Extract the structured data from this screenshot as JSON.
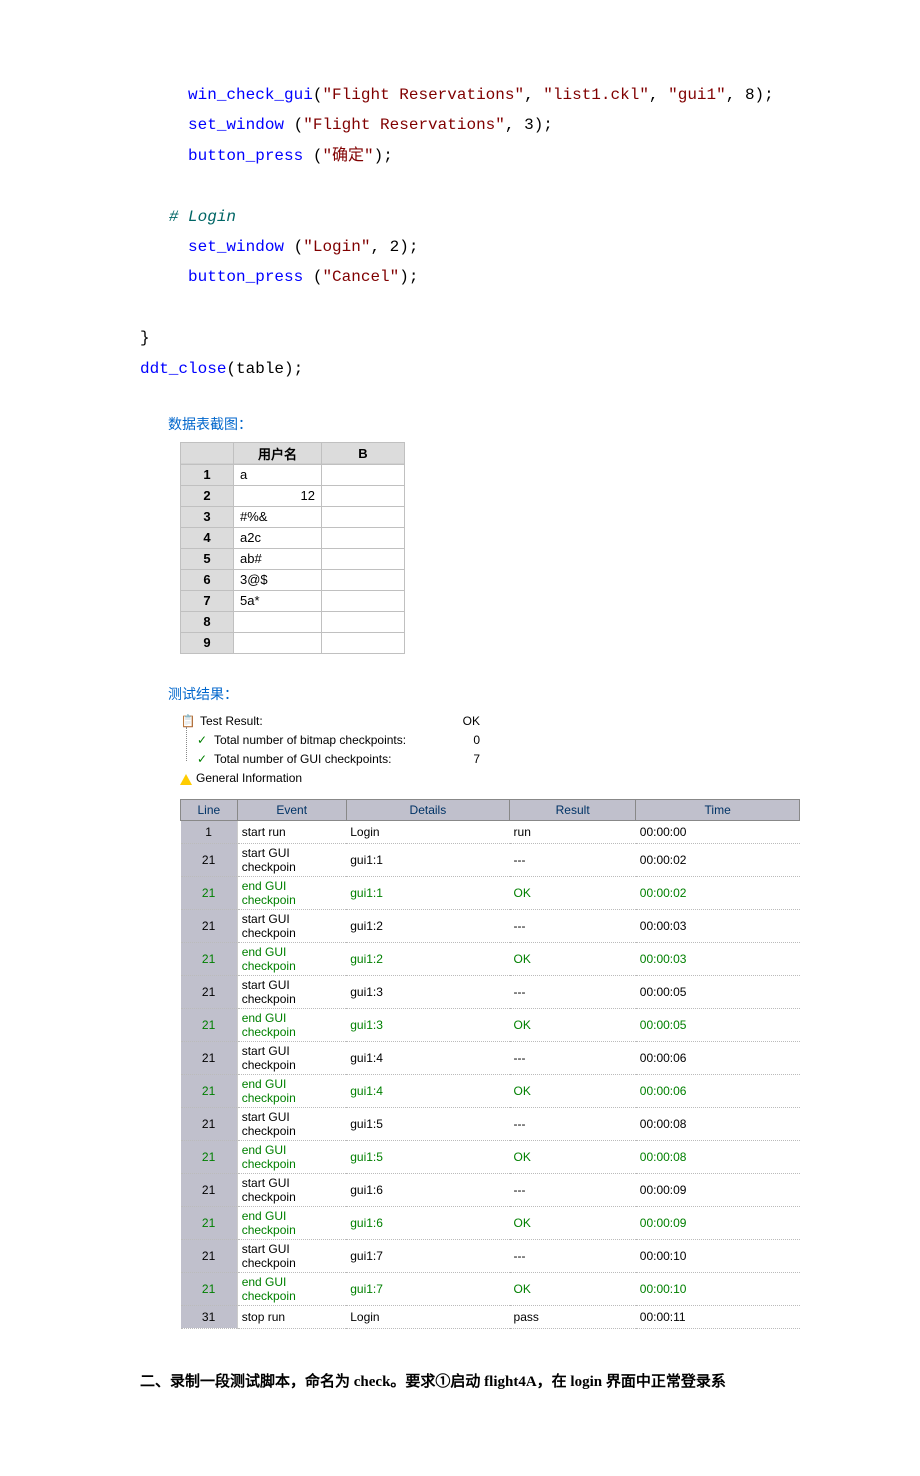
{
  "code": {
    "l1a": "win_check_gui",
    "l1b": "(",
    "l1c": "\"Flight Reservations\"",
    "l1d": ", ",
    "l1e": "\"list1.ckl\"",
    "l1f": ", ",
    "l1g": "\"gui1\"",
    "l1h": ", ",
    "l1i": "8",
    "l1j": ");",
    "l2a": "set_window",
    "l2b": " (",
    "l2c": "\"Flight Reservations\"",
    "l2d": ", ",
    "l2e": "3",
    "l2f": ");",
    "l3a": "button_press",
    "l3b": " (",
    "l3c": "\"确定\"",
    "l3d": ");",
    "comment": "# Login",
    "l4a": "set_window",
    "l4b": " (",
    "l4c": "\"Login\"",
    "l4d": ", ",
    "l4e": "2",
    "l4f": ");",
    "l5a": "button_press",
    "l5b": " (",
    "l5c": "\"Cancel\"",
    "l5d": ");",
    "brace": "}",
    "close": "ddt_close",
    "closeArg": "(table);"
  },
  "labels": {
    "dataTable": "数据表截图：",
    "testResult": "测试结果："
  },
  "sheet": {
    "header": {
      "username": "用户名",
      "b": "B"
    },
    "rows": [
      {
        "n": "1",
        "a": "a",
        "b": ""
      },
      {
        "n": "2",
        "a": "12",
        "b": "",
        "right": true
      },
      {
        "n": "3",
        "a": "#%&",
        "b": ""
      },
      {
        "n": "4",
        "a": "a2c",
        "b": ""
      },
      {
        "n": "5",
        "a": "ab#",
        "b": ""
      },
      {
        "n": "6",
        "a": "3@$",
        "b": ""
      },
      {
        "n": "7",
        "a": "5a*",
        "b": ""
      },
      {
        "n": "8",
        "a": "",
        "b": ""
      },
      {
        "n": "9",
        "a": "",
        "b": ""
      }
    ]
  },
  "tree": {
    "r1": {
      "label": "Test Result:",
      "val": "OK"
    },
    "r2": {
      "label": "Total number of bitmap checkpoints:",
      "val": "0"
    },
    "r3": {
      "label": "Total number of GUI checkpoints:",
      "val": "7"
    },
    "r4": {
      "label": "General Information"
    }
  },
  "results": {
    "headers": {
      "line": "Line",
      "event": "Event",
      "details": "Details",
      "result": "Result",
      "time": "Time"
    },
    "rows": [
      {
        "line": "1",
        "event": "start run",
        "details": "Login",
        "result": "run",
        "time": "00:00:00",
        "green": false
      },
      {
        "line": "21",
        "event": "start GUI checkpoin",
        "details": "gui1:1",
        "result": "---",
        "time": "00:00:02",
        "green": false
      },
      {
        "line": "21",
        "event": "end GUI checkpoin",
        "details": "gui1:1",
        "result": "OK",
        "time": "00:00:02",
        "green": true
      },
      {
        "line": "21",
        "event": "start GUI checkpoin",
        "details": "gui1:2",
        "result": "---",
        "time": "00:00:03",
        "green": false
      },
      {
        "line": "21",
        "event": "end GUI checkpoin",
        "details": "gui1:2",
        "result": "OK",
        "time": "00:00:03",
        "green": true
      },
      {
        "line": "21",
        "event": "start GUI checkpoin",
        "details": "gui1:3",
        "result": "---",
        "time": "00:00:05",
        "green": false
      },
      {
        "line": "21",
        "event": "end GUI checkpoin",
        "details": "gui1:3",
        "result": "OK",
        "time": "00:00:05",
        "green": true
      },
      {
        "line": "21",
        "event": "start GUI checkpoin",
        "details": "gui1:4",
        "result": "---",
        "time": "00:00:06",
        "green": false
      },
      {
        "line": "21",
        "event": "end GUI checkpoin",
        "details": "gui1:4",
        "result": "OK",
        "time": "00:00:06",
        "green": true
      },
      {
        "line": "21",
        "event": "start GUI checkpoin",
        "details": "gui1:5",
        "result": "---",
        "time": "00:00:08",
        "green": false
      },
      {
        "line": "21",
        "event": "end GUI checkpoin",
        "details": "gui1:5",
        "result": "OK",
        "time": "00:00:08",
        "green": true
      },
      {
        "line": "21",
        "event": "start GUI checkpoin",
        "details": "gui1:6",
        "result": "---",
        "time": "00:00:09",
        "green": false
      },
      {
        "line": "21",
        "event": "end GUI checkpoin",
        "details": "gui1:6",
        "result": "OK",
        "time": "00:00:09",
        "green": true
      },
      {
        "line": "21",
        "event": "start GUI checkpoin",
        "details": "gui1:7",
        "result": "---",
        "time": "00:00:10",
        "green": false
      },
      {
        "line": "21",
        "event": "end GUI checkpoin",
        "details": "gui1:7",
        "result": "OK",
        "time": "00:00:10",
        "green": true
      },
      {
        "line": "31",
        "event": "stop run",
        "details": "Login",
        "result": "pass",
        "time": "00:00:11",
        "green": false
      }
    ]
  },
  "bottom": "二、录制一段测试脚本，命名为 check。要求①启动 flight4A，在 login 界面中正常登录系"
}
